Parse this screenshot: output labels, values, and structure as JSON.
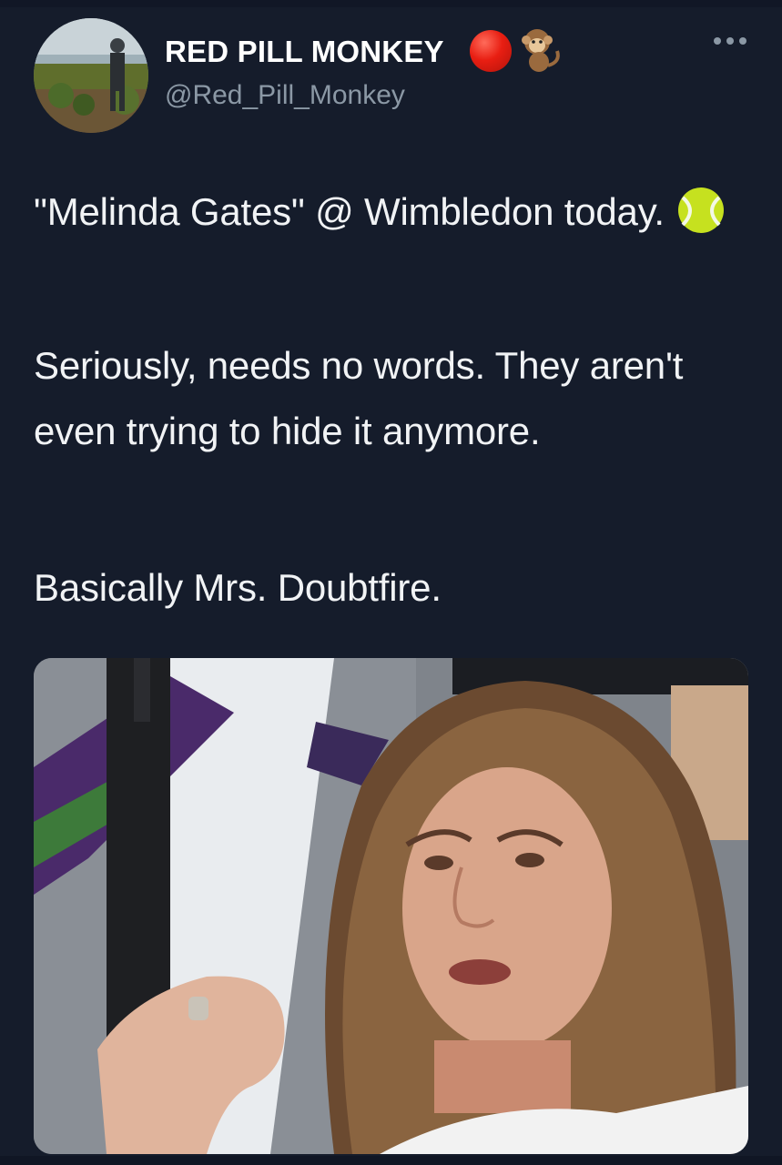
{
  "tweet": {
    "author_name": "RED PILL MONKEY",
    "author_handle": "@Red_Pill_Monkey",
    "paragraphs": {
      "p1": "\"Melinda Gates\" @ Wimbledon today.",
      "p2": "Seriously, needs no words. They aren't even trying to hide it anymore.",
      "p3": "Basically Mrs. Doubtfire."
    }
  },
  "icons": {
    "badge_1": "red-circle-icon",
    "badge_2": "monkey-icon",
    "inline": "tennis-ball-icon",
    "menu": "more-options-icon"
  },
  "colors": {
    "background": "#151c2b",
    "text": "#f1f3f5",
    "handle": "#8b98a5",
    "red_badge": "#e81e12"
  }
}
